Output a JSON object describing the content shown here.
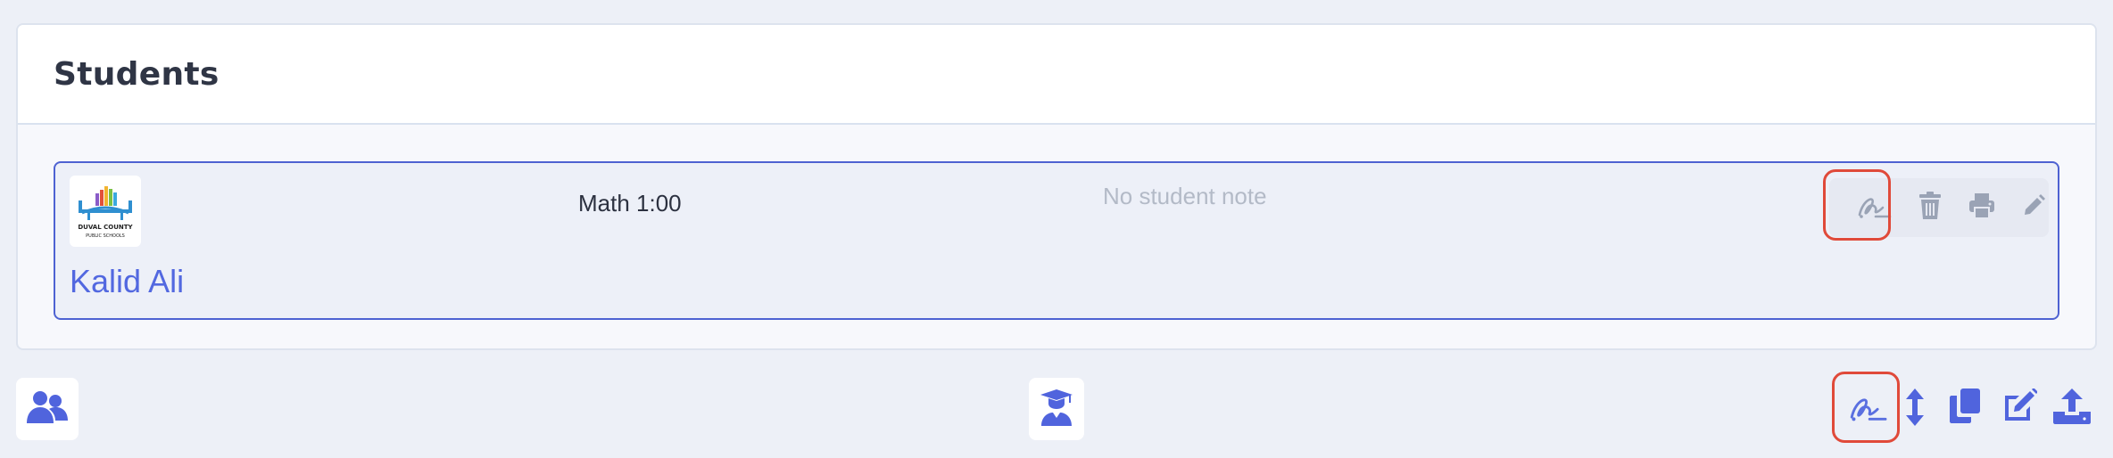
{
  "panel": {
    "title": "Students"
  },
  "student_card": {
    "name": "Kalid Ali",
    "class_time": "Math 1:00",
    "note": "No student note",
    "logo": {
      "icon": "duval-county-public-schools-logo",
      "line1": "DUVAL COUNTY",
      "line2": "PUBLIC SCHOOLS"
    },
    "actions": [
      {
        "icon": "signature-icon",
        "highlighted": true
      },
      {
        "icon": "trash-icon"
      },
      {
        "icon": "print-icon"
      },
      {
        "icon": "pencil-icon"
      }
    ]
  },
  "footer": {
    "left": {
      "icon": "users-icon"
    },
    "center": {
      "icon": "graduate-icon"
    },
    "right": [
      {
        "icon": "signature-icon",
        "highlighted": true
      },
      {
        "icon": "vertical-arrows-icon"
      },
      {
        "icon": "copy-icon"
      },
      {
        "icon": "edit-icon"
      },
      {
        "icon": "upload-icon"
      }
    ]
  },
  "colors": {
    "page_background": "#edf0f7",
    "accent_blue": "#4e62d2",
    "name_blue": "#5268e0",
    "muted_gray": "#9aa3b5",
    "highlight_red": "#e04a3a"
  }
}
